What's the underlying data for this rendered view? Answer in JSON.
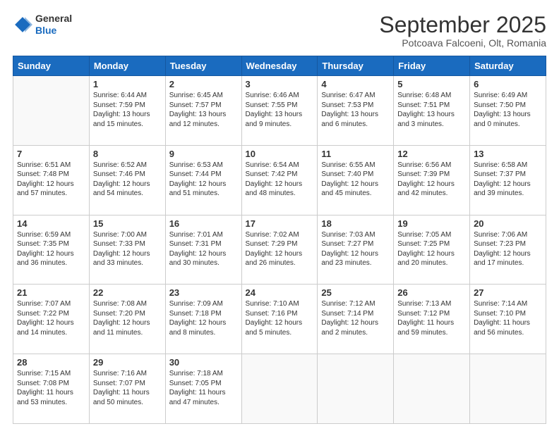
{
  "header": {
    "logo_general": "General",
    "logo_blue": "Blue",
    "month_title": "September 2025",
    "location": "Potcoava Falcoeni, Olt, Romania"
  },
  "days_of_week": [
    "Sunday",
    "Monday",
    "Tuesday",
    "Wednesday",
    "Thursday",
    "Friday",
    "Saturday"
  ],
  "weeks": [
    [
      {
        "day": "",
        "info": ""
      },
      {
        "day": "1",
        "info": "Sunrise: 6:44 AM\nSunset: 7:59 PM\nDaylight: 13 hours\nand 15 minutes."
      },
      {
        "day": "2",
        "info": "Sunrise: 6:45 AM\nSunset: 7:57 PM\nDaylight: 13 hours\nand 12 minutes."
      },
      {
        "day": "3",
        "info": "Sunrise: 6:46 AM\nSunset: 7:55 PM\nDaylight: 13 hours\nand 9 minutes."
      },
      {
        "day": "4",
        "info": "Sunrise: 6:47 AM\nSunset: 7:53 PM\nDaylight: 13 hours\nand 6 minutes."
      },
      {
        "day": "5",
        "info": "Sunrise: 6:48 AM\nSunset: 7:51 PM\nDaylight: 13 hours\nand 3 minutes."
      },
      {
        "day": "6",
        "info": "Sunrise: 6:49 AM\nSunset: 7:50 PM\nDaylight: 13 hours\nand 0 minutes."
      }
    ],
    [
      {
        "day": "7",
        "info": "Sunrise: 6:51 AM\nSunset: 7:48 PM\nDaylight: 12 hours\nand 57 minutes."
      },
      {
        "day": "8",
        "info": "Sunrise: 6:52 AM\nSunset: 7:46 PM\nDaylight: 12 hours\nand 54 minutes."
      },
      {
        "day": "9",
        "info": "Sunrise: 6:53 AM\nSunset: 7:44 PM\nDaylight: 12 hours\nand 51 minutes."
      },
      {
        "day": "10",
        "info": "Sunrise: 6:54 AM\nSunset: 7:42 PM\nDaylight: 12 hours\nand 48 minutes."
      },
      {
        "day": "11",
        "info": "Sunrise: 6:55 AM\nSunset: 7:40 PM\nDaylight: 12 hours\nand 45 minutes."
      },
      {
        "day": "12",
        "info": "Sunrise: 6:56 AM\nSunset: 7:39 PM\nDaylight: 12 hours\nand 42 minutes."
      },
      {
        "day": "13",
        "info": "Sunrise: 6:58 AM\nSunset: 7:37 PM\nDaylight: 12 hours\nand 39 minutes."
      }
    ],
    [
      {
        "day": "14",
        "info": "Sunrise: 6:59 AM\nSunset: 7:35 PM\nDaylight: 12 hours\nand 36 minutes."
      },
      {
        "day": "15",
        "info": "Sunrise: 7:00 AM\nSunset: 7:33 PM\nDaylight: 12 hours\nand 33 minutes."
      },
      {
        "day": "16",
        "info": "Sunrise: 7:01 AM\nSunset: 7:31 PM\nDaylight: 12 hours\nand 30 minutes."
      },
      {
        "day": "17",
        "info": "Sunrise: 7:02 AM\nSunset: 7:29 PM\nDaylight: 12 hours\nand 26 minutes."
      },
      {
        "day": "18",
        "info": "Sunrise: 7:03 AM\nSunset: 7:27 PM\nDaylight: 12 hours\nand 23 minutes."
      },
      {
        "day": "19",
        "info": "Sunrise: 7:05 AM\nSunset: 7:25 PM\nDaylight: 12 hours\nand 20 minutes."
      },
      {
        "day": "20",
        "info": "Sunrise: 7:06 AM\nSunset: 7:23 PM\nDaylight: 12 hours\nand 17 minutes."
      }
    ],
    [
      {
        "day": "21",
        "info": "Sunrise: 7:07 AM\nSunset: 7:22 PM\nDaylight: 12 hours\nand 14 minutes."
      },
      {
        "day": "22",
        "info": "Sunrise: 7:08 AM\nSunset: 7:20 PM\nDaylight: 12 hours\nand 11 minutes."
      },
      {
        "day": "23",
        "info": "Sunrise: 7:09 AM\nSunset: 7:18 PM\nDaylight: 12 hours\nand 8 minutes."
      },
      {
        "day": "24",
        "info": "Sunrise: 7:10 AM\nSunset: 7:16 PM\nDaylight: 12 hours\nand 5 minutes."
      },
      {
        "day": "25",
        "info": "Sunrise: 7:12 AM\nSunset: 7:14 PM\nDaylight: 12 hours\nand 2 minutes."
      },
      {
        "day": "26",
        "info": "Sunrise: 7:13 AM\nSunset: 7:12 PM\nDaylight: 11 hours\nand 59 minutes."
      },
      {
        "day": "27",
        "info": "Sunrise: 7:14 AM\nSunset: 7:10 PM\nDaylight: 11 hours\nand 56 minutes."
      }
    ],
    [
      {
        "day": "28",
        "info": "Sunrise: 7:15 AM\nSunset: 7:08 PM\nDaylight: 11 hours\nand 53 minutes."
      },
      {
        "day": "29",
        "info": "Sunrise: 7:16 AM\nSunset: 7:07 PM\nDaylight: 11 hours\nand 50 minutes."
      },
      {
        "day": "30",
        "info": "Sunrise: 7:18 AM\nSunset: 7:05 PM\nDaylight: 11 hours\nand 47 minutes."
      },
      {
        "day": "",
        "info": ""
      },
      {
        "day": "",
        "info": ""
      },
      {
        "day": "",
        "info": ""
      },
      {
        "day": "",
        "info": ""
      }
    ]
  ]
}
